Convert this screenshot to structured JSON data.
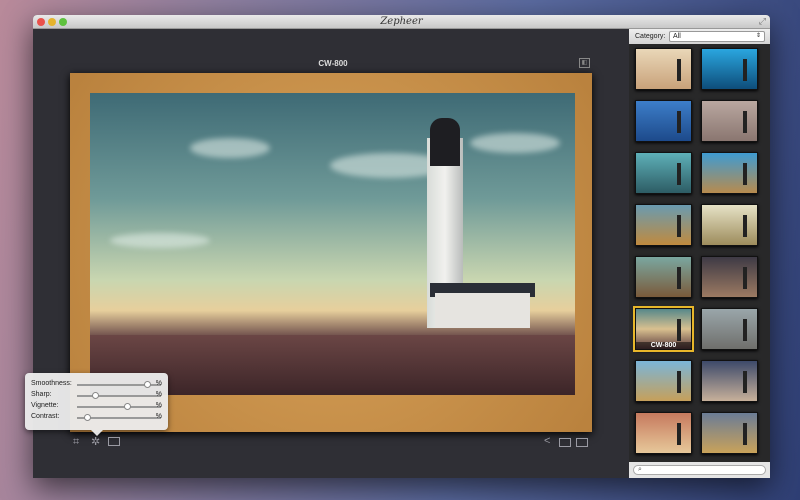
{
  "window": {
    "title": "Zepheer",
    "image_name": "CW-800"
  },
  "sidebar": {
    "category_label": "Category:",
    "category_value": "All",
    "search_placeholder": "",
    "thumbnails": [
      {
        "caption": "",
        "bg": "linear-gradient(#e9d7b8,#c9a27a)"
      },
      {
        "caption": "",
        "bg": "linear-gradient(#2aa6df,#0e4d7a)"
      },
      {
        "caption": "",
        "bg": "linear-gradient(#3d7ec9,#1d4a8b)"
      },
      {
        "caption": "",
        "bg": "linear-gradient(#b9a7a0,#8a7670)"
      },
      {
        "caption": "",
        "bg": "linear-gradient(#5eb0b8,#2d5c64)"
      },
      {
        "caption": "",
        "bg": "linear-gradient(#3f9bd1,#b88b4e)"
      },
      {
        "caption": "",
        "bg": "linear-gradient(#6a9bb0,#c08a3e)"
      },
      {
        "caption": "",
        "bg": "linear-gradient(#e6e2c6,#9d8c5c)"
      },
      {
        "caption": "",
        "bg": "linear-gradient(#7aa7a0,#7a5a3a)"
      },
      {
        "caption": "",
        "bg": "linear-gradient(#3e3a45,#9c7a62)"
      },
      {
        "caption": "CW-800",
        "bg": "linear-gradient(#56888a,#d9c08f,#5a3a3e)"
      },
      {
        "caption": "",
        "bg": "linear-gradient(#9aa6aa,#6f6f6c)"
      },
      {
        "caption": "",
        "bg": "linear-gradient(#7bb5d8,#c6a05a)"
      },
      {
        "caption": "",
        "bg": "linear-gradient(#3d4a6a,#c7b09a)"
      },
      {
        "caption": "",
        "bg": "linear-gradient(#c67a5e,#e7c89a)"
      },
      {
        "caption": "",
        "bg": "linear-gradient(#6b7c96,#c9a25a)"
      }
    ]
  },
  "adjustments": [
    {
      "label": "Smoothness:",
      "value": 0.83,
      "unit": "%"
    },
    {
      "label": "Sharp:",
      "value": 0.22,
      "unit": "%"
    },
    {
      "label": "Vignette:",
      "value": 0.6,
      "unit": "%"
    },
    {
      "label": "Contrast:",
      "value": 0.12,
      "unit": "%"
    }
  ]
}
